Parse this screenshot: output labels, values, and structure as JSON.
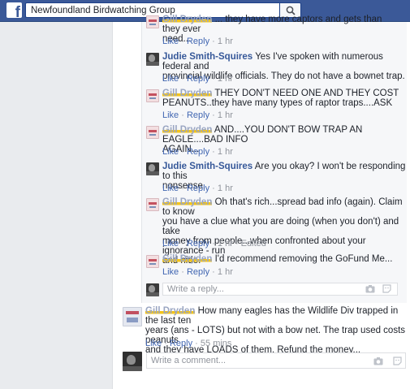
{
  "header": {
    "search_value": "Newfoundland Birdwatching Group"
  },
  "replies": [
    {
      "author": "Gill Dryden",
      "text_lines": [
        "... they have more captors and gets than they ever",
        "need..."
      ],
      "actions": [
        "Like",
        "Reply"
      ],
      "time": "1 hr"
    },
    {
      "author": "Judie Smith-Squires",
      "text_lines": [
        "Yes I've spoken with numerous federal and",
        "provincial wildlife officials. They do not have a bownet trap."
      ],
      "actions": [
        "Like",
        "Reply"
      ],
      "time": "1 hr"
    },
    {
      "author": "Gill Dryden",
      "text_lines": [
        "THEY DON'T NEED ONE AND THEY COST",
        "PEANUTS..they have many types of raptor traps....ASK"
      ],
      "actions": [
        "Like",
        "Reply"
      ],
      "time": "1 hr"
    },
    {
      "author": "Gill Dryden",
      "text_lines": [
        "AND....YOU DON'T BOW TRAP AN EAGLE....BAD INFO",
        "AGAIN..."
      ],
      "actions": [
        "Like",
        "Reply"
      ],
      "time": "1 hr"
    },
    {
      "author": "Judie Smith-Squires",
      "text_lines": [
        "Are you okay? I won't be responding to this",
        "nonsense."
      ],
      "actions": [
        "Like",
        "Reply"
      ],
      "time": "1 hr"
    },
    {
      "author": "Gill Dryden",
      "text_lines": [
        "Oh that's rich...spread bad info (again). Claim to know",
        "you have a clue what you are doing (when you don't) and take",
        "money from people...when confronted about your ignorance - run",
        "and hide."
      ],
      "actions": [
        "Like",
        "Reply"
      ],
      "time": "1 hr",
      "edited": "Edited"
    },
    {
      "author": "Gill Dryden",
      "text_lines": [
        "I'd recommend removing the GoFund Me..."
      ],
      "actions": [
        "Like",
        "Reply"
      ],
      "time": "1 hr"
    }
  ],
  "reply_box": {
    "placeholder": "Write a reply..."
  },
  "main_comment": {
    "author": "Gill Dryden",
    "text_lines": [
      "How many eagles has the Wildlife Div trapped in the last ten",
      "years (ans - LOTS) but not with a bow net. The trap used costs peanuts",
      "and they have LOADS of them. Refund the money..."
    ],
    "actions": [
      "Like",
      "Reply"
    ],
    "time": "55 mins"
  },
  "comment_box": {
    "placeholder": "Write a comment..."
  },
  "icons": {
    "logo": "facebook-logo",
    "search": "search-icon",
    "camera": "camera-icon",
    "sticker": "sticker-icon"
  }
}
